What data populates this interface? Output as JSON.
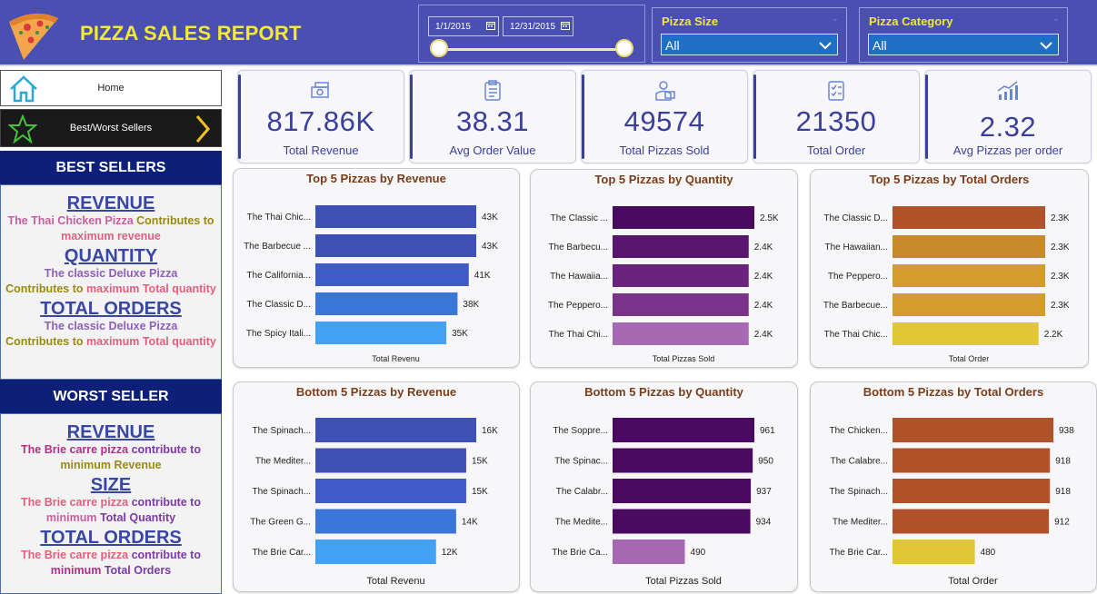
{
  "header": {
    "title": "PIZZA SALES REPORT",
    "date_start": "1/1/2015",
    "date_end": "12/31/2015",
    "slicers": [
      {
        "label": "Pizza Size",
        "value": "All"
      },
      {
        "label": "Pizza Category",
        "value": "All"
      }
    ]
  },
  "nav": {
    "home": "Home",
    "best_worst": "Best/Worst Sellers"
  },
  "best": {
    "title": "BEST SELLERS",
    "revenue_heading": "REVENUE",
    "revenue_pizza": "The Thai Chicken Pizza",
    "revenue_text1": " Contributes to",
    "revenue_text2": "maximum revenue",
    "quantity_heading": "QUANTITY",
    "quantity_pizza": "The classic Deluxe Pizza",
    "quantity_text1": "Contributes to ",
    "quantity_text2": "maximum Total quantity",
    "orders_heading": "TOTAL ORDERS",
    "orders_pizza": "The classic Deluxe Pizza",
    "orders_text1": "Contributes to ",
    "orders_text2": "maximum Total quantity"
  },
  "worst": {
    "title": "WORST SELLER",
    "revenue_heading": "REVENUE",
    "revenue_pizza": "The Brie carre pizza",
    "revenue_text1": "  contribute  to",
    "revenue_text2": "minimum Revenue",
    "size_heading": "SIZE",
    "size_pizza": "The Brie carre pizza",
    "size_text1": " contribute to",
    "size_text2a": "minimum",
    "size_text2b": "  Total Quantity",
    "orders_heading": "TOTAL ORDERS",
    "orders_pizza": "The Brie carre pizza",
    "orders_text1": " contribute to",
    "orders_text2a": "minimum",
    "orders_text2b": "  Total Orders"
  },
  "kpis": [
    {
      "value": "817.86K",
      "label": "Total Revenue",
      "icon": "money-icon"
    },
    {
      "value": "38.31",
      "label": "Avg Order Value",
      "icon": "clipboard-icon"
    },
    {
      "value": "49574",
      "label": "Total Pizzas Sold",
      "icon": "delivery-icon"
    },
    {
      "value": "21350",
      "label": "Total Order",
      "icon": "checklist-icon"
    },
    {
      "value": "2.32",
      "label": "Avg Pizzas per order",
      "icon": "growth-chart-icon"
    }
  ],
  "chart_data": [
    {
      "type": "bar",
      "title": "Top 5 Pizzas by Revenue",
      "xlabel": "Total Revenu",
      "categories": [
        "The Thai Chic...",
        "The Barbecue ...",
        "The California...",
        "The Classic D...",
        "The Spicy Itali..."
      ],
      "values": [
        43,
        43,
        41,
        38,
        35
      ],
      "labels": [
        "43K",
        "43K",
        "41K",
        "38K",
        "35K"
      ],
      "colors": [
        "#3f51b5",
        "#3f51b5",
        "#3f5bc8",
        "#3a75d8",
        "#42a1f2"
      ]
    },
    {
      "type": "bar",
      "title": "Top 5 Pizzas by Quantity",
      "xlabel": "Total Pizzas Sold",
      "categories": [
        "The Classic ...",
        "The Barbecu...",
        "The Hawaiia...",
        "The Peppero...",
        "The Thai Chi..."
      ],
      "values": [
        2.5,
        2.4,
        2.4,
        2.4,
        2.4
      ],
      "labels": [
        "2.5K",
        "2.4K",
        "2.4K",
        "2.4K",
        "2.4K"
      ],
      "colors": [
        "#4b0a61",
        "#5a1570",
        "#6a237e",
        "#7a338b",
        "#a768b4"
      ]
    },
    {
      "type": "bar",
      "title": "Top 5 Pizzas by Total Orders",
      "xlabel": "Total Order",
      "categories": [
        "The Classic D...",
        "The Hawaiian...",
        "The Peppero...",
        "The Barbecue...",
        "The Thai Chic..."
      ],
      "values": [
        2.3,
        2.3,
        2.3,
        2.3,
        2.2
      ],
      "labels": [
        "2.3K",
        "2.3K",
        "2.3K",
        "2.3K",
        "2.2K"
      ],
      "colors": [
        "#b0532a",
        "#c98a2b",
        "#d49b2d",
        "#d49b2d",
        "#e1c636"
      ]
    },
    {
      "type": "bar",
      "title": "Bottom 5 Pizzas by Revenue",
      "xlabel": "Total Revenu",
      "categories": [
        "The Spinach...",
        "The Mediter...",
        "The Spinach...",
        "The Green G...",
        "The Brie Car..."
      ],
      "values": [
        16,
        15,
        15,
        14,
        12
      ],
      "labels": [
        "16K",
        "15K",
        "15K",
        "14K",
        "12K"
      ],
      "colors": [
        "#3f51b5",
        "#3f51b5",
        "#3f5bc8",
        "#3a75d8",
        "#42a1f2"
      ]
    },
    {
      "type": "bar",
      "title": "Bottom 5 Pizzas by Quantity",
      "xlabel": "Total Pizzas Sold",
      "categories": [
        "The Soppre...",
        "The Spinac...",
        "The Calabr...",
        "The Medite...",
        "The Brie Ca..."
      ],
      "values": [
        961,
        950,
        937,
        934,
        490
      ],
      "labels": [
        "961",
        "950",
        "937",
        "934",
        "490"
      ],
      "colors": [
        "#4b0a61",
        "#4b0a61",
        "#4b0a61",
        "#4b0a61",
        "#a768b4"
      ]
    },
    {
      "type": "bar",
      "title": "Bottom 5 Pizzas by Total Orders",
      "xlabel": "Total Order",
      "categories": [
        "The Chicken...",
        "The Calabre...",
        "The Spinach...",
        "The Mediter...",
        "The Brie Car..."
      ],
      "values": [
        938,
        918,
        918,
        912,
        480
      ],
      "labels": [
        "938",
        "918",
        "918",
        "912",
        "480"
      ],
      "colors": [
        "#b0532a",
        "#b0532a",
        "#b0532a",
        "#b0532a",
        "#e1c636"
      ]
    }
  ]
}
